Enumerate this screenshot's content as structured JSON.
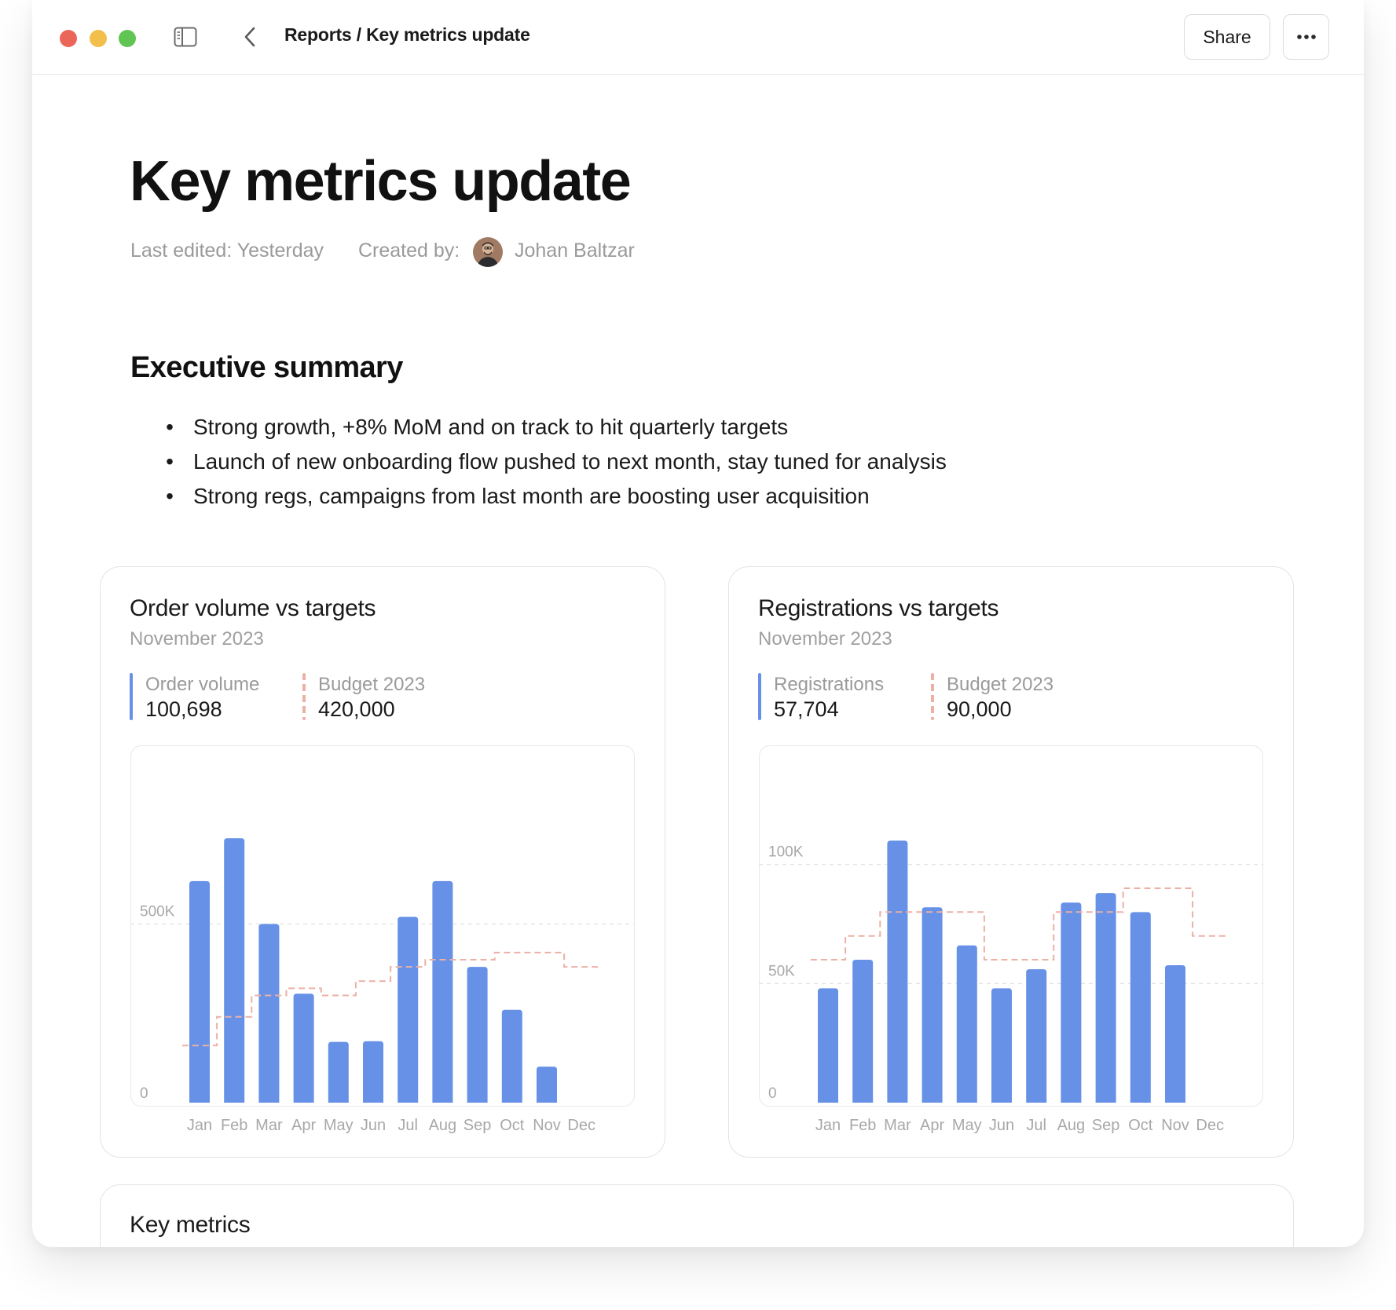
{
  "topbar": {
    "breadcrumb": "Reports / Key metrics update",
    "share_label": "Share",
    "icons": {
      "sidebar_toggle": "sidebar-toggle-icon",
      "back": "chevron-left-icon",
      "more": "ellipsis-icon"
    },
    "traffic_lights": {
      "close_color": "#ec6559",
      "minimize_color": "#f2bf4d",
      "maximize_color": "#61c553"
    }
  },
  "page": {
    "title": "Key metrics update",
    "last_edited": "Last edited: Yesterday",
    "created_by_label": "Created by:",
    "author": "Johan Baltzar"
  },
  "summary": {
    "heading": "Executive summary",
    "items": [
      "Strong growth, +8% MoM and on track to hit quarterly targets",
      "Launch of new onboarding flow pushed to next month, stay tuned for analysis",
      "Strong regs, campaigns from last month are boosting user acquisition"
    ]
  },
  "cards": {
    "orders": {
      "title": "Order volume vs targets",
      "subtitle": "November 2023",
      "legend": [
        {
          "label": "Order volume",
          "value": "100,698"
        },
        {
          "label": "Budget 2023",
          "value": "420,000"
        }
      ]
    },
    "registrations": {
      "title": "Registrations vs targets",
      "subtitle": "November 2023",
      "legend": [
        {
          "label": "Registrations",
          "value": "57,704"
        },
        {
          "label": "Budget 2023",
          "value": "90,000"
        }
      ]
    },
    "key_metrics": {
      "title": "Key metrics"
    }
  },
  "colors": {
    "bar": "#6691e6",
    "budget_line": "#ecb0a5",
    "gridline": "#e2e2e2",
    "axis_text": "#a8a8a8"
  },
  "chart_data": [
    {
      "type": "bar",
      "title": "Order volume vs targets",
      "categories": [
        "Jan",
        "Feb",
        "Mar",
        "Apr",
        "May",
        "Jun",
        "Jul",
        "Aug",
        "Sep",
        "Oct",
        "Nov",
        "Dec"
      ],
      "yticks": [
        {
          "value": 0,
          "label": "0"
        },
        {
          "value": 500000,
          "label": "500K"
        }
      ],
      "ylim": [
        0,
        1000000
      ],
      "grid": true,
      "series": [
        {
          "name": "Order volume",
          "kind": "bar",
          "values": [
            620000,
            740000,
            500000,
            305000,
            170000,
            172000,
            520000,
            620000,
            380000,
            260000,
            100698,
            null
          ]
        },
        {
          "name": "Budget 2023",
          "kind": "step-dashed",
          "values": [
            160000,
            240000,
            300000,
            320000,
            300000,
            340000,
            380000,
            400000,
            400000,
            420000,
            420000,
            380000
          ]
        }
      ]
    },
    {
      "type": "bar",
      "title": "Registrations vs targets",
      "categories": [
        "Jan",
        "Feb",
        "Mar",
        "Apr",
        "May",
        "Jun",
        "Jul",
        "Aug",
        "Sep",
        "Oct",
        "Nov",
        "Dec"
      ],
      "yticks": [
        {
          "value": 0,
          "label": "0"
        },
        {
          "value": 50000,
          "label": "50K"
        },
        {
          "value": 100000,
          "label": "100K"
        }
      ],
      "ylim": [
        0,
        150000
      ],
      "grid": true,
      "series": [
        {
          "name": "Registrations",
          "kind": "bar",
          "values": [
            48000,
            60000,
            110000,
            82000,
            66000,
            48000,
            56000,
            84000,
            88000,
            80000,
            57704,
            null
          ]
        },
        {
          "name": "Budget 2023",
          "kind": "step-dashed",
          "values": [
            60000,
            70000,
            80000,
            80000,
            80000,
            60000,
            60000,
            80000,
            80000,
            90000,
            90000,
            70000
          ]
        }
      ]
    }
  ]
}
